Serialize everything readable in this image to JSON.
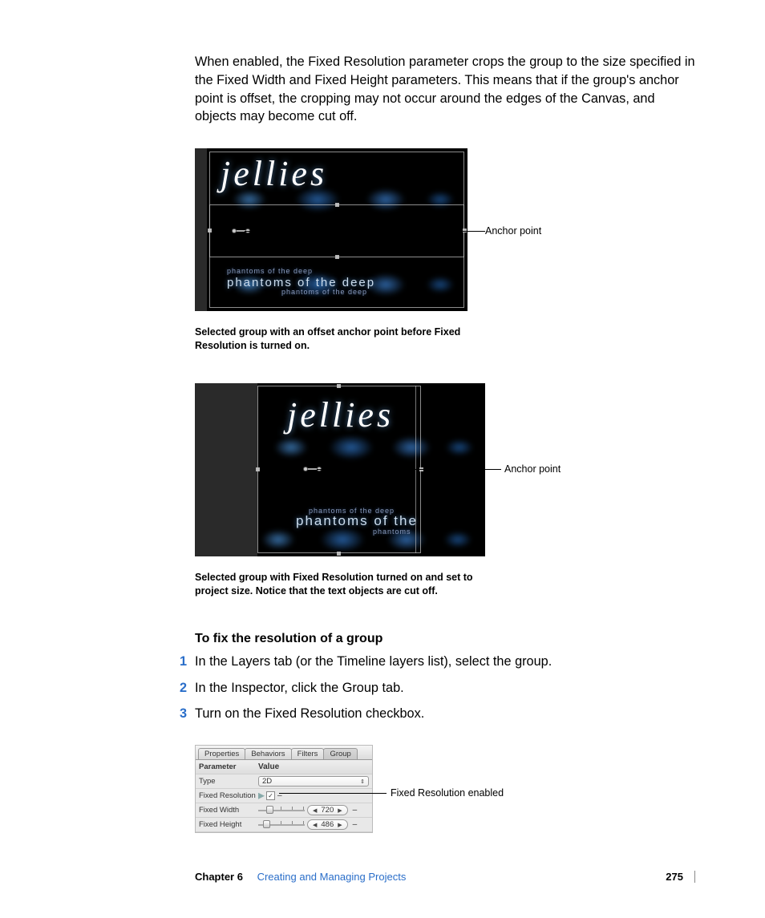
{
  "body_text": "When enabled, the Fixed Resolution parameter crops the group to the size specified in the Fixed Width and Fixed Height parameters. This means that if the group's anchor point is offset, the cropping may not occur around the edges of the Canvas, and objects may become cut off.",
  "figure1": {
    "title_text": "jellies",
    "overlay_main": "phantoms of the deep",
    "overlay_shadow": "phantoms of the deep",
    "callout": "Anchor point",
    "caption": "Selected group with an offset anchor point before Fixed Resolution is turned on."
  },
  "figure2": {
    "title_text": "jellies",
    "overlay_main": "phantoms of the",
    "overlay_shadow_top": "phantoms of the deep",
    "overlay_shadow_bottom": "phantoms",
    "callout": "Anchor point",
    "caption": "Selected group with Fixed Resolution turned on and set to project size. Notice that the text objects are cut off."
  },
  "heading": "To fix the resolution of a group",
  "steps": {
    "s1_num": "1",
    "s1_text": "In the Layers tab (or the Timeline layers list), select the group.",
    "s2_num": "2",
    "s2_text": "In the Inspector, click the Group tab.",
    "s3_num": "3",
    "s3_text": "Turn on the Fixed Resolution checkbox."
  },
  "inspector": {
    "tabs": {
      "properties": "Properties",
      "behaviors": "Behaviors",
      "filters": "Filters",
      "group": "Group"
    },
    "header_param": "Parameter",
    "header_value": "Value",
    "row_type_label": "Type",
    "row_type_value": "2D",
    "row_fixedres_label": "Fixed Resolution",
    "checkmark": "✓",
    "row_fixedwidth_label": "Fixed Width",
    "row_fixedwidth_value": "720",
    "row_fixedheight_label": "Fixed Height",
    "row_fixedheight_value": "486",
    "callout": "Fixed Resolution enabled"
  },
  "footer": {
    "chapter_label": "Chapter 6",
    "chapter_title": "Creating and Managing Projects",
    "page": "275"
  }
}
